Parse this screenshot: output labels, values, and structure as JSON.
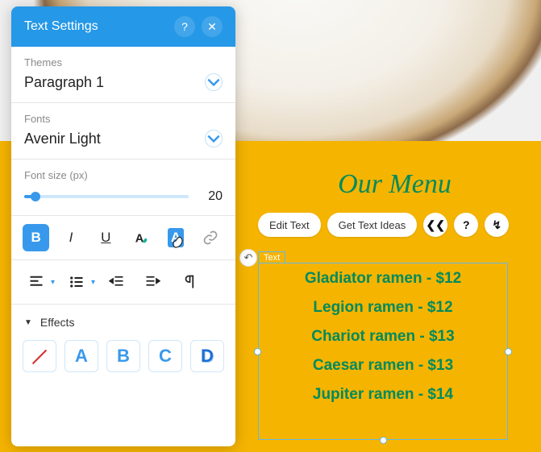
{
  "panel": {
    "title": "Text Settings",
    "help": "?",
    "close": "✕",
    "themes": {
      "label": "Themes",
      "value": "Paragraph 1"
    },
    "fonts": {
      "label": "Fonts",
      "value": "Avenir Light"
    },
    "fontsize": {
      "label": "Font size (px)",
      "value": "20"
    },
    "format": {
      "bold": "B",
      "italic": "I",
      "underline": "U",
      "textcolor": "A",
      "highlight": "A",
      "link": "🔗"
    },
    "paragraph": {
      "align": "≡",
      "list": "≣",
      "outdent": "⇤",
      "indent": "⇥",
      "direction": "¶"
    },
    "effects": {
      "label": "Effects",
      "presets": [
        "",
        "A",
        "B",
        "C",
        "D"
      ]
    }
  },
  "canvas": {
    "menu_title": "Our Menu",
    "edit_text": "Edit Text",
    "get_ideas": "Get Text Ideas",
    "text_label": "Text",
    "undo": "↶",
    "items": [
      "Gladiator ramen - $12",
      "Legion ramen - $12",
      "Chariot ramen - $13",
      "Caesar ramen - $13",
      "Jupiter ramen - $14"
    ]
  }
}
